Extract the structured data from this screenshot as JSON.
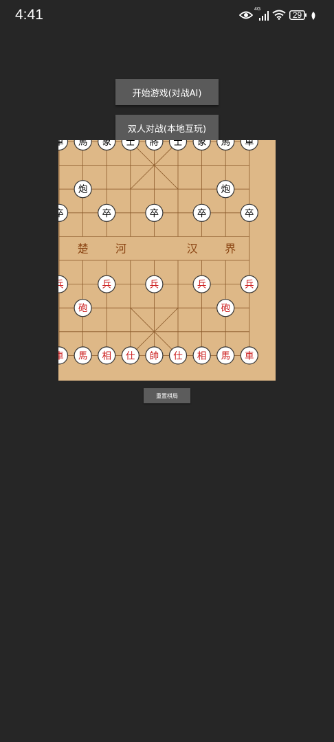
{
  "status_bar": {
    "time": "4:41",
    "network": "4G",
    "battery": "29"
  },
  "menu": {
    "start_ai": "开始游戏(对战AI)",
    "two_player": "双人对战(本地互玩)"
  },
  "board": {
    "river_labels": [
      "楚",
      "河",
      "汉",
      "界"
    ],
    "colors": {
      "board": "#deb887",
      "line": "#8b5a2b",
      "red_piece_text": "#cc1e1e",
      "black_piece_text": "#000000",
      "piece_fill": "#ffffff",
      "river_text": "#8b4513"
    },
    "pieces": [
      {
        "side": "black",
        "label": "車",
        "file": 0,
        "rank": 0
      },
      {
        "side": "black",
        "label": "馬",
        "file": 1,
        "rank": 0
      },
      {
        "side": "black",
        "label": "象",
        "file": 2,
        "rank": 0
      },
      {
        "side": "black",
        "label": "士",
        "file": 3,
        "rank": 0
      },
      {
        "side": "black",
        "label": "將",
        "file": 4,
        "rank": 0
      },
      {
        "side": "black",
        "label": "士",
        "file": 5,
        "rank": 0
      },
      {
        "side": "black",
        "label": "象",
        "file": 6,
        "rank": 0
      },
      {
        "side": "black",
        "label": "馬",
        "file": 7,
        "rank": 0
      },
      {
        "side": "black",
        "label": "車",
        "file": 8,
        "rank": 0
      },
      {
        "side": "black",
        "label": "炮",
        "file": 1,
        "rank": 2
      },
      {
        "side": "black",
        "label": "炮",
        "file": 7,
        "rank": 2
      },
      {
        "side": "black",
        "label": "卒",
        "file": 0,
        "rank": 3
      },
      {
        "side": "black",
        "label": "卒",
        "file": 2,
        "rank": 3
      },
      {
        "side": "black",
        "label": "卒",
        "file": 4,
        "rank": 3
      },
      {
        "side": "black",
        "label": "卒",
        "file": 6,
        "rank": 3
      },
      {
        "side": "black",
        "label": "卒",
        "file": 8,
        "rank": 3
      },
      {
        "side": "red",
        "label": "兵",
        "file": 0,
        "rank": 6
      },
      {
        "side": "red",
        "label": "兵",
        "file": 2,
        "rank": 6
      },
      {
        "side": "red",
        "label": "兵",
        "file": 4,
        "rank": 6
      },
      {
        "side": "red",
        "label": "兵",
        "file": 6,
        "rank": 6
      },
      {
        "side": "red",
        "label": "兵",
        "file": 8,
        "rank": 6
      },
      {
        "side": "red",
        "label": "砲",
        "file": 1,
        "rank": 7
      },
      {
        "side": "red",
        "label": "砲",
        "file": 7,
        "rank": 7
      },
      {
        "side": "red",
        "label": "車",
        "file": 0,
        "rank": 9
      },
      {
        "side": "red",
        "label": "馬",
        "file": 1,
        "rank": 9
      },
      {
        "side": "red",
        "label": "相",
        "file": 2,
        "rank": 9
      },
      {
        "side": "red",
        "label": "仕",
        "file": 3,
        "rank": 9
      },
      {
        "side": "red",
        "label": "帥",
        "file": 4,
        "rank": 9
      },
      {
        "side": "red",
        "label": "仕",
        "file": 5,
        "rank": 9
      },
      {
        "side": "red",
        "label": "相",
        "file": 6,
        "rank": 9
      },
      {
        "side": "red",
        "label": "馬",
        "file": 7,
        "rank": 9
      },
      {
        "side": "red",
        "label": "車",
        "file": 8,
        "rank": 9
      }
    ]
  },
  "reset": {
    "label": "重置棋局"
  }
}
